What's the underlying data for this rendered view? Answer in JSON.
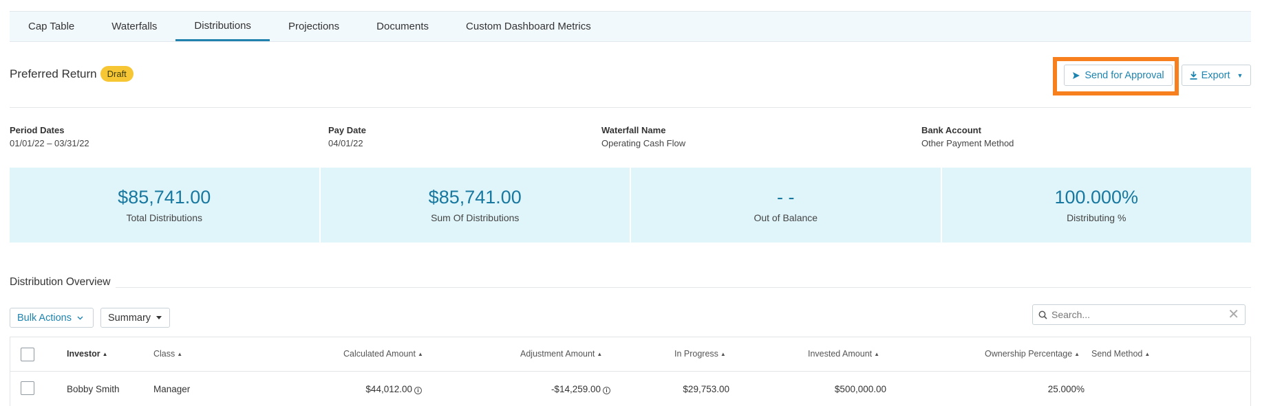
{
  "tabs": [
    {
      "label": "Cap Table",
      "active": false
    },
    {
      "label": "Waterfalls",
      "active": false
    },
    {
      "label": "Distributions",
      "active": true
    },
    {
      "label": "Projections",
      "active": false
    },
    {
      "label": "Documents",
      "active": false
    },
    {
      "label": "Custom Dashboard Metrics",
      "active": false
    }
  ],
  "header": {
    "title": "Preferred Return",
    "status_badge": "Draft",
    "send_for_approval_label": "Send for Approval",
    "export_label": "Export"
  },
  "meta": {
    "period_dates_label": "Period Dates",
    "period_dates_value": "01/01/22 – 03/31/22",
    "pay_date_label": "Pay Date",
    "pay_date_value": "04/01/22",
    "waterfall_name_label": "Waterfall Name",
    "waterfall_name_value": "Operating Cash Flow",
    "bank_account_label": "Bank Account",
    "bank_account_value": "Other Payment Method"
  },
  "stats": [
    {
      "value": "$85,741.00",
      "label": "Total Distributions"
    },
    {
      "value": "$85,741.00",
      "label": "Sum Of Distributions"
    },
    {
      "value": "- -",
      "label": "Out of Balance"
    },
    {
      "value": "100.000%",
      "label": "Distributing %"
    }
  ],
  "overview": {
    "title": "Distribution Overview",
    "bulk_actions_label": "Bulk Actions",
    "view_select_value": "Summary",
    "search_placeholder": "Search..."
  },
  "table": {
    "columns": {
      "investor": "Investor",
      "class": "Class",
      "calculated_amount": "Calculated Amount",
      "adjustment_amount": "Adjustment Amount",
      "in_progress": "In Progress",
      "invested_amount": "Invested Amount",
      "ownership_percentage": "Ownership Percentage",
      "send_method": "Send Method"
    },
    "rows": [
      {
        "investor": "Bobby Smith",
        "class": "Manager",
        "calculated_amount": "$44,012.00",
        "adjustment_amount": "-$14,259.00",
        "in_progress": "$29,753.00",
        "invested_amount": "$500,000.00",
        "ownership_percentage": "25.000%",
        "send_method": ""
      }
    ]
  },
  "colors": {
    "accent": "#1d84b0",
    "highlight": "#f77f1d",
    "badge": "#f6c634",
    "stat_bg": "#dff5fa"
  }
}
